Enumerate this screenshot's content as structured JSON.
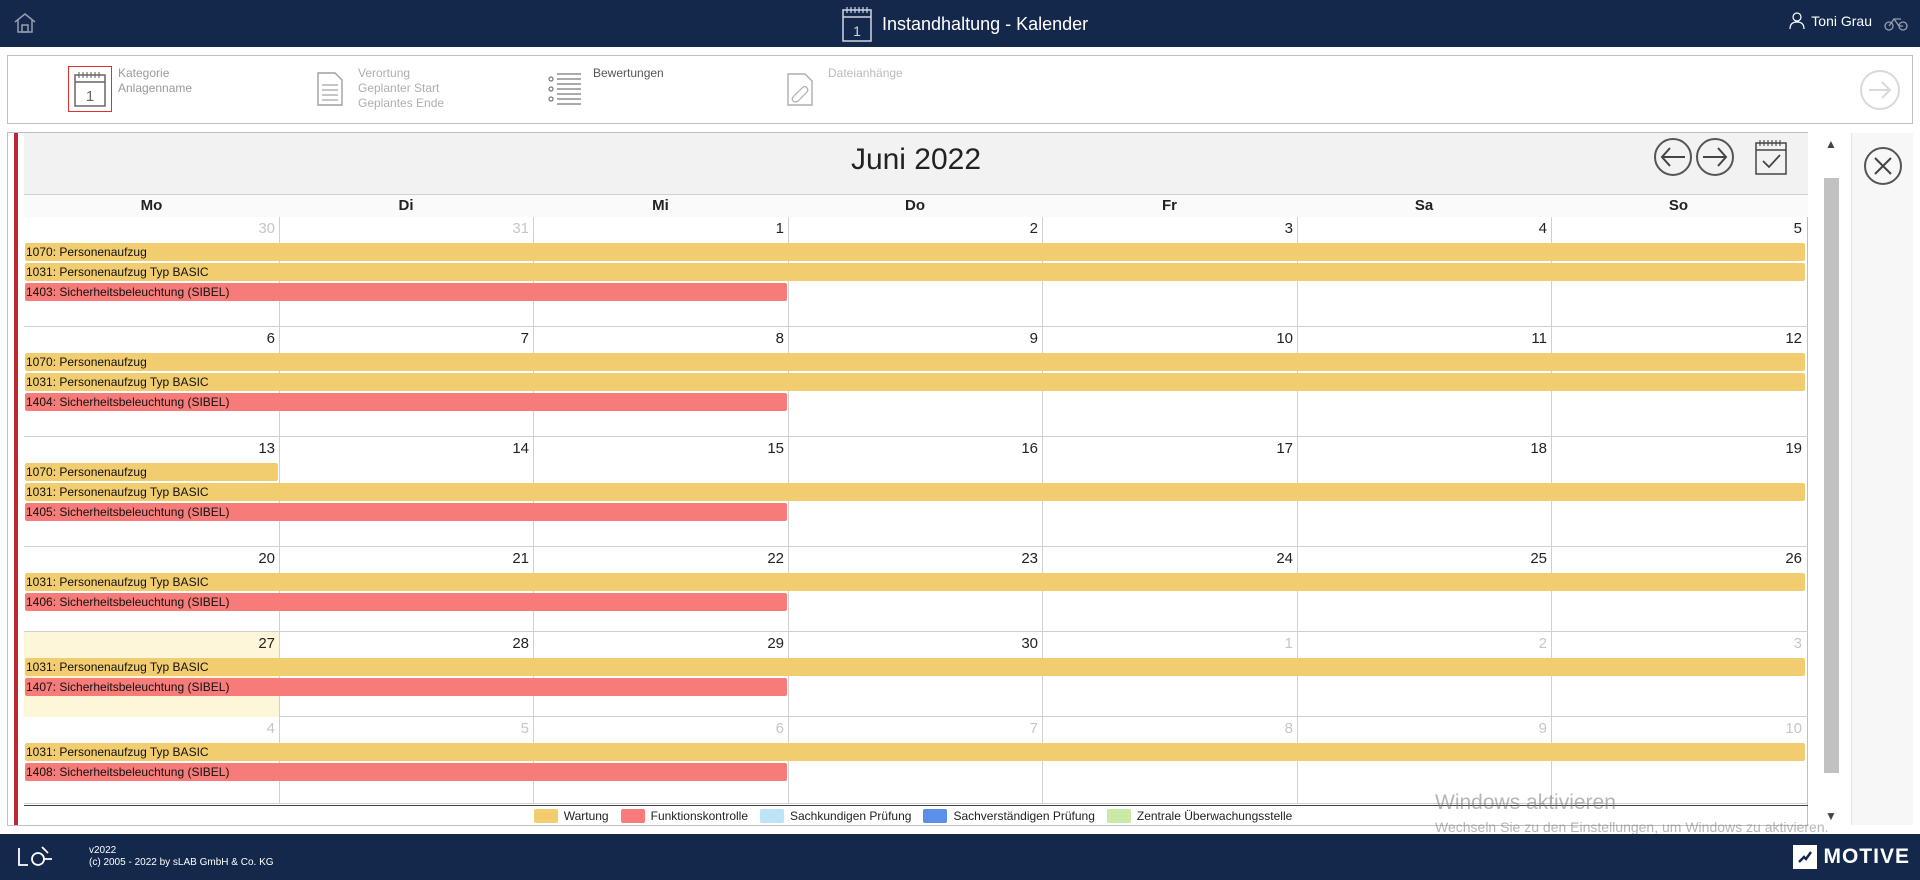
{
  "header": {
    "title": "Instandhaltung - Kalender",
    "calendar_icon_number": "1",
    "user_name": "Toni Grau"
  },
  "steps": [
    {
      "lines": [
        "Kategorie",
        "Anlagenname"
      ],
      "icon": "calendar-icon"
    },
    {
      "lines": [
        "Verortung",
        "Geplanter Start",
        "Geplantes Ende"
      ],
      "icon": "document-icon"
    },
    {
      "lines": [
        "Bewertungen"
      ],
      "icon": "list-icon"
    },
    {
      "lines": [
        "Dateianhänge"
      ],
      "icon": "attachment-icon"
    }
  ],
  "calendar": {
    "month_title": "Juni 2022",
    "weekdays": [
      "Mo",
      "Di",
      "Mi",
      "Do",
      "Fr",
      "Sa",
      "So"
    ],
    "weeks": [
      {
        "days": [
          "30",
          "31",
          "1",
          "2",
          "3",
          "4",
          "5"
        ],
        "other": [
          true,
          true,
          false,
          false,
          false,
          false,
          false
        ],
        "events": [
          {
            "label": "1070: Personenaufzug",
            "type": "wartung",
            "start": 0,
            "span": 7
          },
          {
            "label": "1031: Personenaufzug Typ BASIC",
            "type": "wartung",
            "start": 0,
            "span": 7
          },
          {
            "label": "1403: Sicherheitsbeleuchtung (SIBEL)",
            "type": "funktion",
            "start": 0,
            "span": 3
          }
        ]
      },
      {
        "days": [
          "6",
          "7",
          "8",
          "9",
          "10",
          "11",
          "12"
        ],
        "other": [
          false,
          false,
          false,
          false,
          false,
          false,
          false
        ],
        "events": [
          {
            "label": "1070: Personenaufzug",
            "type": "wartung",
            "start": 0,
            "span": 7
          },
          {
            "label": "1031: Personenaufzug Typ BASIC",
            "type": "wartung",
            "start": 0,
            "span": 7
          },
          {
            "label": "1404: Sicherheitsbeleuchtung (SIBEL)",
            "type": "funktion",
            "start": 0,
            "span": 3
          }
        ]
      },
      {
        "days": [
          "13",
          "14",
          "15",
          "16",
          "17",
          "18",
          "19"
        ],
        "other": [
          false,
          false,
          false,
          false,
          false,
          false,
          false
        ],
        "events": [
          {
            "label": "1070: Personenaufzug",
            "type": "wartung",
            "start": 0,
            "span": 1
          },
          {
            "label": "1031: Personenaufzug Typ BASIC",
            "type": "wartung",
            "start": 0,
            "span": 7
          },
          {
            "label": "1405: Sicherheitsbeleuchtung (SIBEL)",
            "type": "funktion",
            "start": 0,
            "span": 3
          }
        ]
      },
      {
        "days": [
          "20",
          "21",
          "22",
          "23",
          "24",
          "25",
          "26"
        ],
        "other": [
          false,
          false,
          false,
          false,
          false,
          false,
          false
        ],
        "events": [
          {
            "label": "1031: Personenaufzug Typ BASIC",
            "type": "wartung",
            "start": 0,
            "span": 7
          },
          {
            "label": "1406: Sicherheitsbeleuchtung (SIBEL)",
            "type": "funktion",
            "start": 0,
            "span": 3
          }
        ]
      },
      {
        "days": [
          "27",
          "28",
          "29",
          "30",
          "1",
          "2",
          "3"
        ],
        "other": [
          false,
          false,
          false,
          false,
          true,
          true,
          true
        ],
        "today_index": 0,
        "events": [
          {
            "label": "1031: Personenaufzug Typ BASIC",
            "type": "wartung",
            "start": 0,
            "span": 7
          },
          {
            "label": "1407: Sicherheitsbeleuchtung (SIBEL)",
            "type": "funktion",
            "start": 0,
            "span": 3
          }
        ]
      },
      {
        "days": [
          "4",
          "5",
          "6",
          "7",
          "8",
          "9",
          "10"
        ],
        "other": [
          true,
          true,
          true,
          true,
          true,
          true,
          true
        ],
        "events": [
          {
            "label": "1031: Personenaufzug Typ BASIC",
            "type": "wartung",
            "start": 0,
            "span": 7
          },
          {
            "label": "1408: Sicherheitsbeleuchtung (SIBEL)",
            "type": "funktion",
            "start": 0,
            "span": 3
          }
        ]
      }
    ]
  },
  "legend": [
    {
      "label": "Wartung",
      "color": "#f2cd6f"
    },
    {
      "label": "Funktionskontrolle",
      "color": "#f77b78"
    },
    {
      "label": "Sachkundigen Prüfung",
      "color": "#bde3f7"
    },
    {
      "label": "Sachverständigen Prüfung",
      "color": "#5b8fea"
    },
    {
      "label": "Zentrale Überwachungsstelle",
      "color": "#c9e9a6"
    }
  ],
  "watermark": {
    "line1": "Windows aktivieren",
    "line2": "Wechseln Sie zu den Einstellungen, um Windows zu aktivieren."
  },
  "footer": {
    "version": "v2022",
    "copyright": "(c) 2005 - 2022 by sLAB GmbH & Co. KG",
    "brand": "MOTIVE"
  },
  "colors": {
    "header_bg": "#13284b",
    "accent_red": "#c0262e",
    "wartung": "#f2cd6f",
    "funktionskontrolle": "#f77b78"
  }
}
